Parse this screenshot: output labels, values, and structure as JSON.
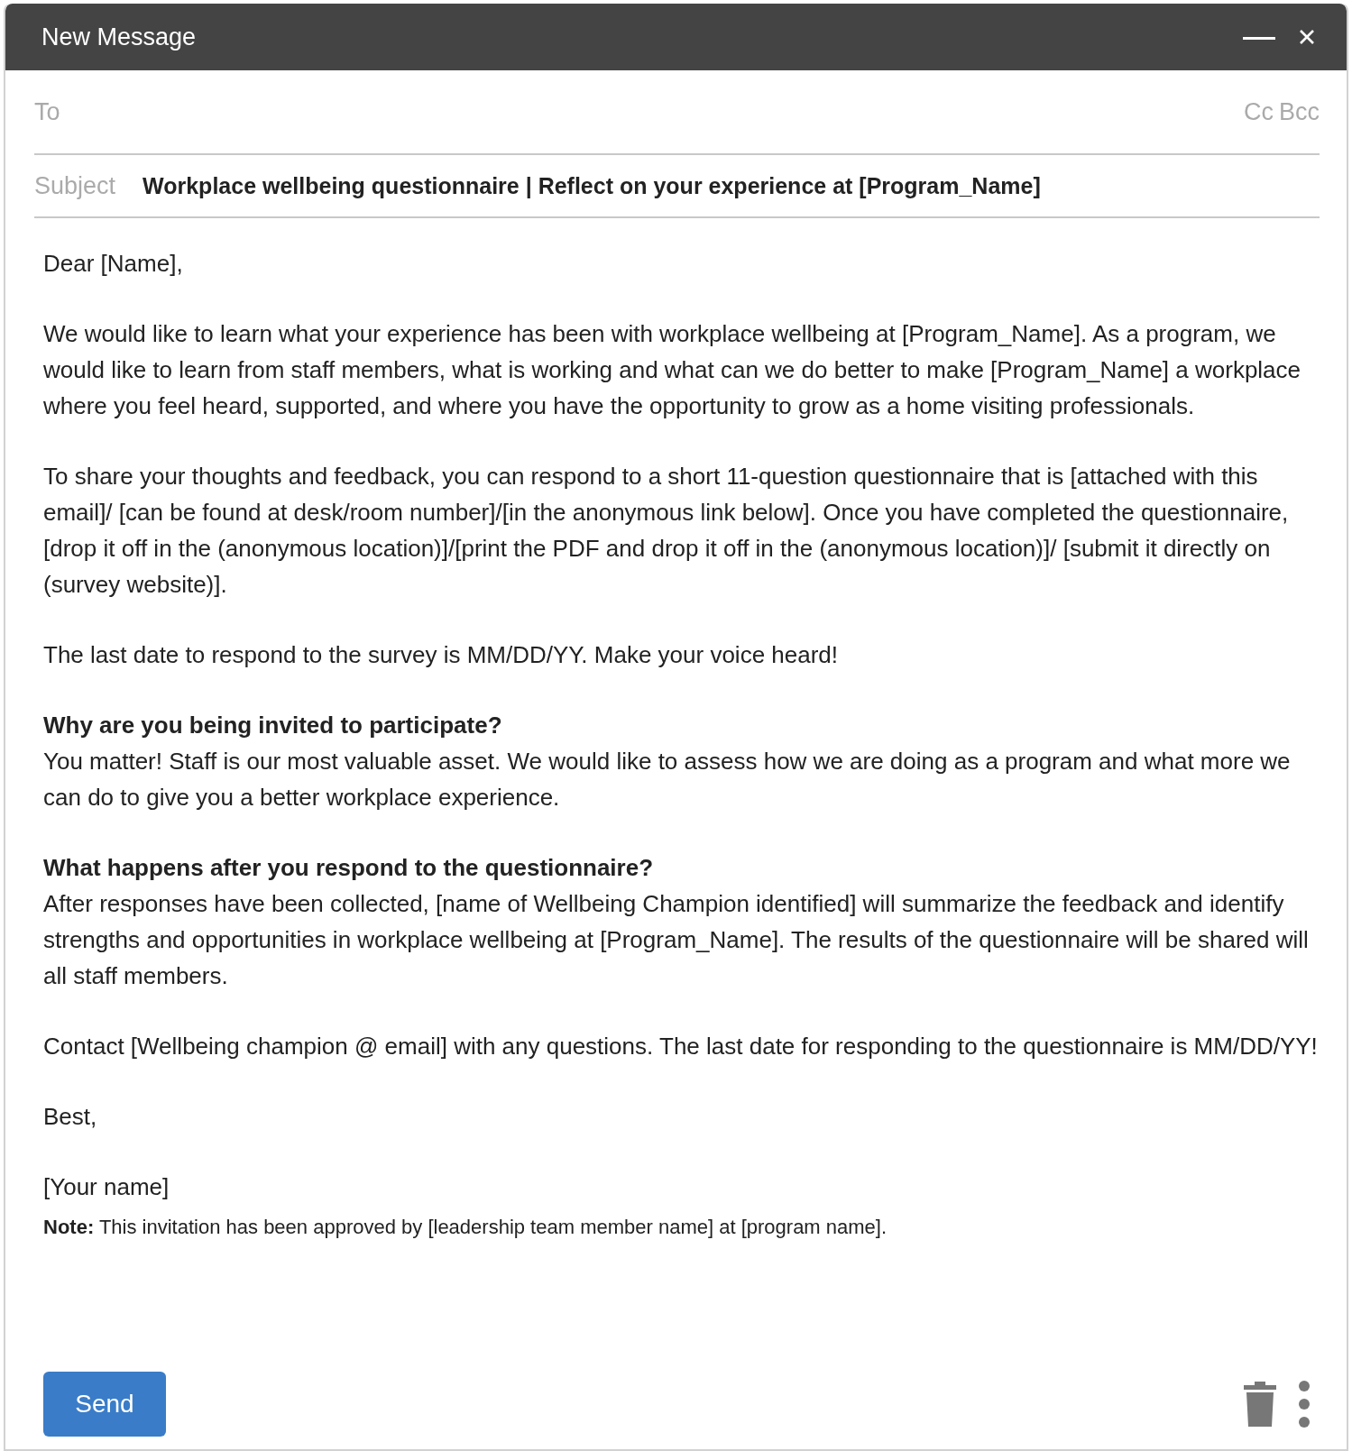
{
  "window": {
    "title": "New Message"
  },
  "to": {
    "placeholder": "To"
  },
  "recipient_links": [
    "Cc",
    "Bcc"
  ],
  "subject": {
    "label": "Subject",
    "value": "Workplace wellbeing questionnaire | Reflect on your experience at [Program_Name]"
  },
  "body": [
    {
      "text": "Dear [Name],"
    },
    {
      "text": "We would like to learn what your experience has been with workplace wellbeing at [Program_Name]. As a program, we would like to learn from staff members, what is working and what can we do better to make [Program_Name] a workplace where you feel heard, supported, and where you have the opportunity to grow as a home visiting professionals."
    },
    {
      "text": "To share your thoughts and feedback, you can respond to a short 11-question questionnaire that is [attached with this email]/ [can be found at desk/room number]/[in the anonymous link below]. Once you have completed the questionnaire, [drop it off in the (anonymous location)]/[print the PDF and drop it off in the (anonymous location)]/ [submit it directly on (survey website)]."
    },
    {
      "text": "The last date to respond to the survey is MM/DD/YY. Make your voice heard!"
    },
    {
      "heading": "Why are you being invited to participate?",
      "text": "You matter! Staff is our most valuable asset. We would like to assess how we are doing as a program and what more we can do to give you a better workplace experience."
    },
    {
      "heading": "What happens after you respond to the questionnaire?",
      "text": "After responses have been collected, [name of Wellbeing Champion identified] will summarize the feedback and identify strengths and opportunities in workplace wellbeing at [Program_Name]. The results of the questionnaire will be shared will all staff members."
    },
    {
      "text": "Contact [Wellbeing champion @ email] with any questions. The last date for responding to the questionnaire is MM/DD/YY!"
    },
    {
      "text": "Best,"
    },
    {
      "text": "[Your name]"
    }
  ],
  "note": "**Note:** This invitation has been approved by [leadership team member name] at [program name].",
  "send_button": "Send"
}
